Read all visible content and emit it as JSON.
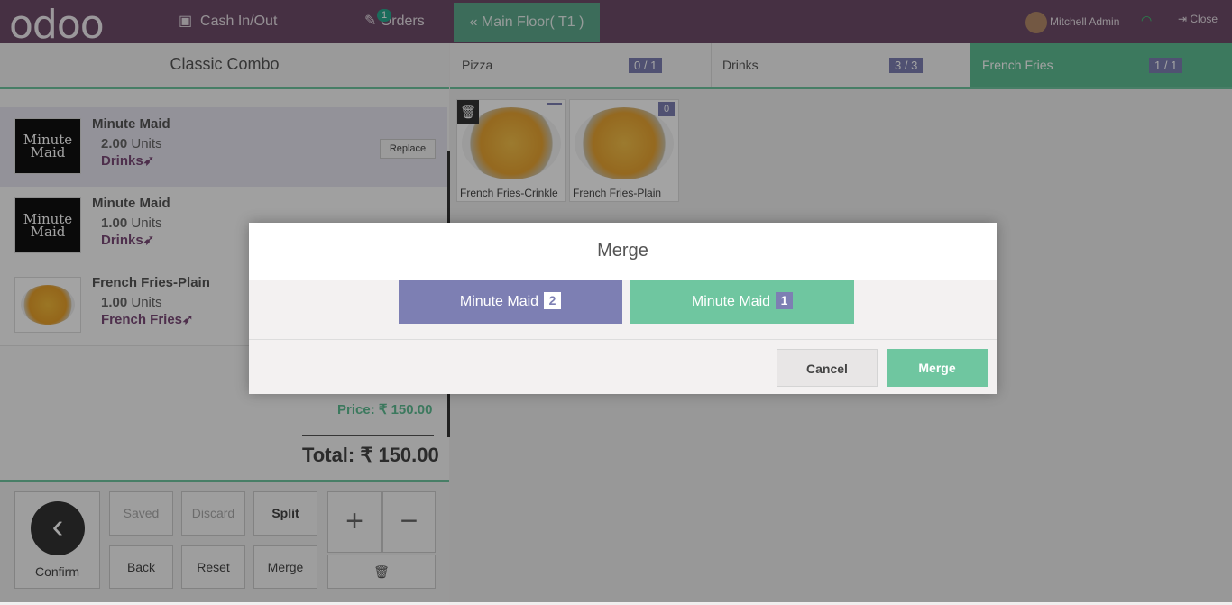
{
  "header": {
    "logo": "odoo",
    "cash_label": "Cash In/Out",
    "orders_label": "Orders",
    "orders_badge": "1",
    "floor_label": "Main Floor( T1 )",
    "user_name": "Mitchell Admin",
    "close_label": "Close"
  },
  "combo": {
    "title": "Classic Combo",
    "lines": [
      {
        "name": "Minute Maid",
        "qty": "2.00",
        "unit": "Units",
        "category": "Drinks",
        "action": "Replace"
      },
      {
        "name": "Minute Maid",
        "qty": "1.00",
        "unit": "Units",
        "category": "Drinks"
      },
      {
        "name": "French Fries-Plain",
        "qty": "1.00",
        "unit": "Units",
        "category": "French Fries"
      }
    ],
    "logo_text_top": "Minute",
    "logo_text_bottom": "Maid",
    "price_label": "Price: ₹ 150.00",
    "total_label": "Total: ₹ 150.00"
  },
  "controls": {
    "confirm": "Confirm",
    "saved": "Saved",
    "discard": "Discard",
    "split": "Split",
    "back": "Back",
    "reset": "Reset",
    "merge": "Merge",
    "plus": "+",
    "minus": "−"
  },
  "tabs": [
    {
      "label": "Pizza",
      "count": "0 / 1"
    },
    {
      "label": "Drinks",
      "count": "3 / 3"
    },
    {
      "label": "French Fries",
      "count": "1 / 1"
    }
  ],
  "products": [
    {
      "name": "French Fries-Crinkle",
      "badge": ""
    },
    {
      "name": "French Fries-Plain",
      "badge": "0"
    }
  ],
  "modal": {
    "title": "Merge",
    "options": [
      {
        "label": "Minute Maid",
        "count": "2"
      },
      {
        "label": "Minute Maid",
        "count": "1"
      }
    ],
    "cancel": "Cancel",
    "confirm": "Merge"
  },
  "colors": {
    "header": "#6e4c6a",
    "accent_green": "#5ebd93",
    "accent_purple": "#7d7fb3"
  }
}
